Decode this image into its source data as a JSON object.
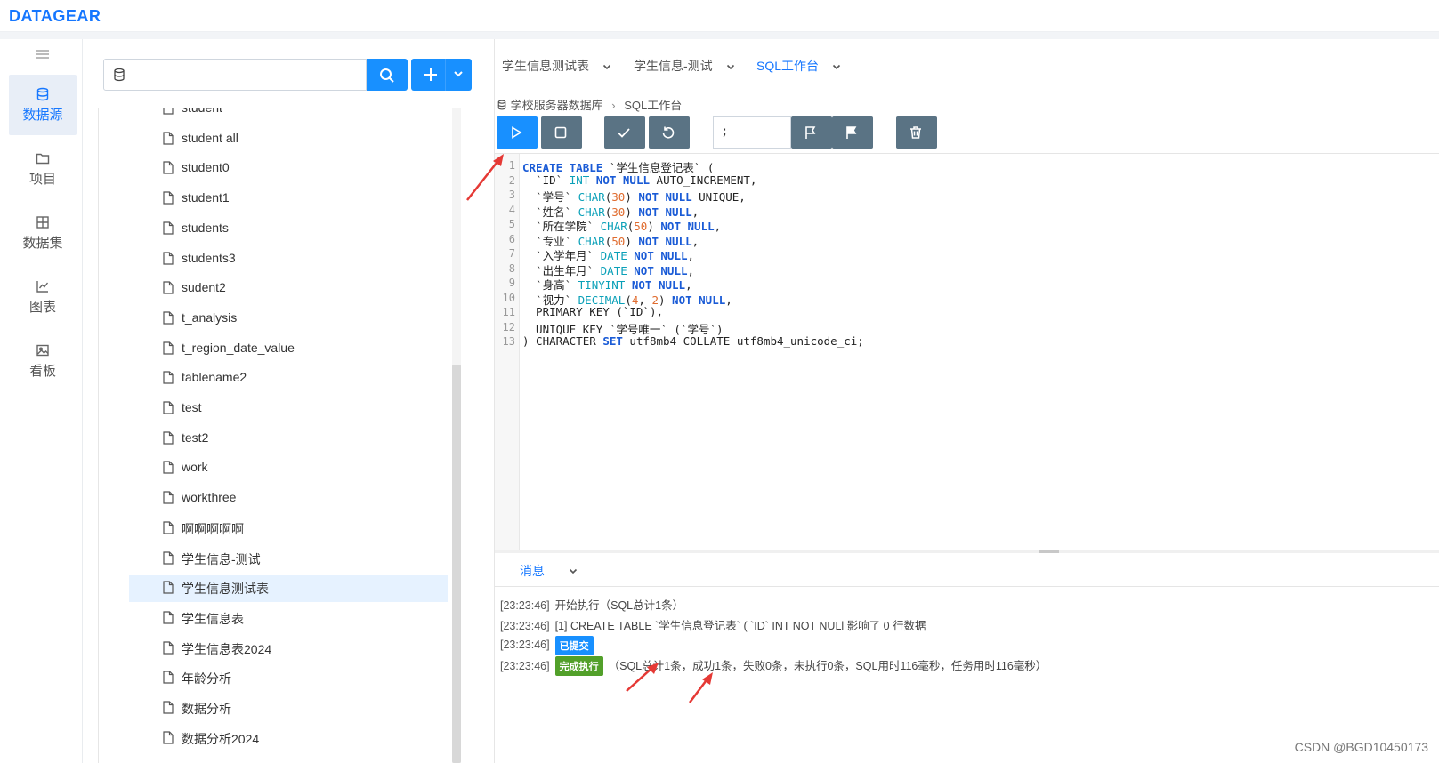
{
  "app": {
    "logo": "DATAGEAR"
  },
  "nav": {
    "items": [
      {
        "label": "数据源",
        "icon": "database-icon",
        "active": true
      },
      {
        "label": "项目",
        "icon": "folder-icon",
        "active": false
      },
      {
        "label": "数据集",
        "icon": "grid-icon",
        "active": false
      },
      {
        "label": "图表",
        "icon": "chart-icon",
        "active": false
      },
      {
        "label": "看板",
        "icon": "image-icon",
        "active": false
      }
    ]
  },
  "datasource": {
    "search": {
      "value": "",
      "placeholder": ""
    },
    "tables": [
      "student",
      "student all",
      "student0",
      "student1",
      "students",
      "students3",
      "sudent2",
      "t_analysis",
      "t_region_date_value",
      "tablename2",
      "test",
      "test2",
      "work",
      "workthree",
      "啊啊啊啊啊",
      "学生信息-测试",
      "学生信息测试表",
      "学生信息表",
      "学生信息表2024",
      "年龄分析",
      "数据分析",
      "数据分析2024"
    ],
    "selected": "学生信息测试表"
  },
  "tabs": [
    {
      "label": "学生信息测试表",
      "active": false
    },
    {
      "label": "学生信息-测试",
      "active": false
    },
    {
      "label": "SQL工作台",
      "active": true
    }
  ],
  "breadcrumb": {
    "database": "学校服务器数据库",
    "page": "SQL工作台"
  },
  "toolbar": {
    "delimiter": ";"
  },
  "editor": {
    "lines": [
      "CREATE TABLE `学生信息登记表` (",
      "  `ID` INT NOT NULL AUTO_INCREMENT,",
      "  `学号` CHAR(30) NOT NULL UNIQUE,",
      "  `姓名` CHAR(30) NOT NULL,",
      "  `所在学院` CHAR(50) NOT NULL,",
      "  `专业` CHAR(50) NOT NULL,",
      "  `入学年月` DATE NOT NULL,",
      "  `出生年月` DATE NOT NULL,",
      "  `身高` TINYINT NOT NULL,",
      "  `视力` DECIMAL(4, 2) NOT NULL,",
      "  PRIMARY KEY (`ID`),",
      "  UNIQUE KEY `学号唯一` (`学号`)",
      ") CHARACTER SET utf8mb4 COLLATE utf8mb4_unicode_ci;"
    ]
  },
  "messages": {
    "tab_label": "消息",
    "logs": [
      {
        "time": "[23:23:46]",
        "badge": "",
        "text": "开始执行（SQL总计1条）"
      },
      {
        "time": "[23:23:46]",
        "badge": "",
        "text": "[1]  CREATE TABLE `学生信息登记表` ( `ID` INT NOT NULl    影响了 0 行数据"
      },
      {
        "time": "[23:23:46]",
        "badge": "已提交",
        "text": ""
      },
      {
        "time": "[23:23:46]",
        "badge": "完成执行",
        "text": "（SQL总计1条，成功1条，失败0条，未执行0条，SQL用时116毫秒，任务用时116毫秒）"
      }
    ]
  },
  "watermark": "CSDN @BGD10450173"
}
